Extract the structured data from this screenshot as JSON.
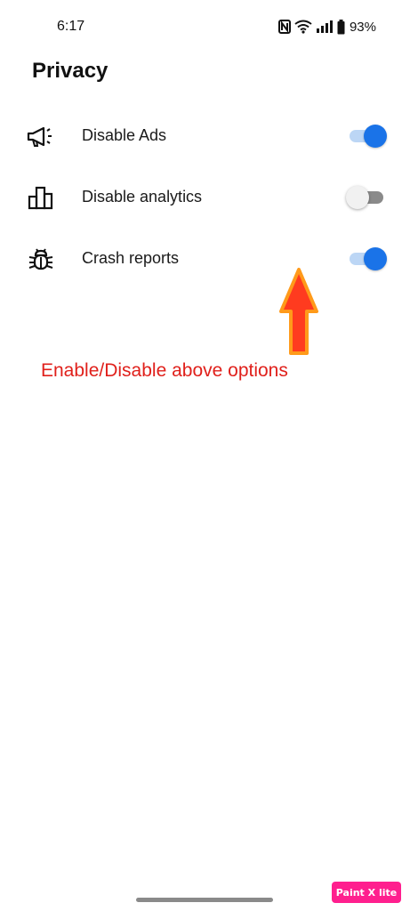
{
  "status_bar": {
    "time": "6:17",
    "battery_percent": "93%",
    "icons": [
      "nfc-icon",
      "wifi-icon",
      "signal-icon",
      "battery-icon"
    ]
  },
  "page": {
    "title": "Privacy"
  },
  "settings": [
    {
      "icon": "megaphone-icon",
      "label": "Disable Ads",
      "enabled": true
    },
    {
      "icon": "bar-chart-icon",
      "label": "Disable analytics",
      "enabled": false
    },
    {
      "icon": "bug-icon",
      "label": "Crash reports",
      "enabled": true
    }
  ],
  "annotation": {
    "text": "Enable/Disable above options",
    "color": "#e0201b",
    "arrow_color": "#ff3b1f"
  },
  "watermark": {
    "text": "Paint X lite"
  },
  "colors": {
    "accent": "#1a73e8",
    "toggle_track_on": "#bcd6f5",
    "toggle_track_off": "#8a8a8a"
  }
}
